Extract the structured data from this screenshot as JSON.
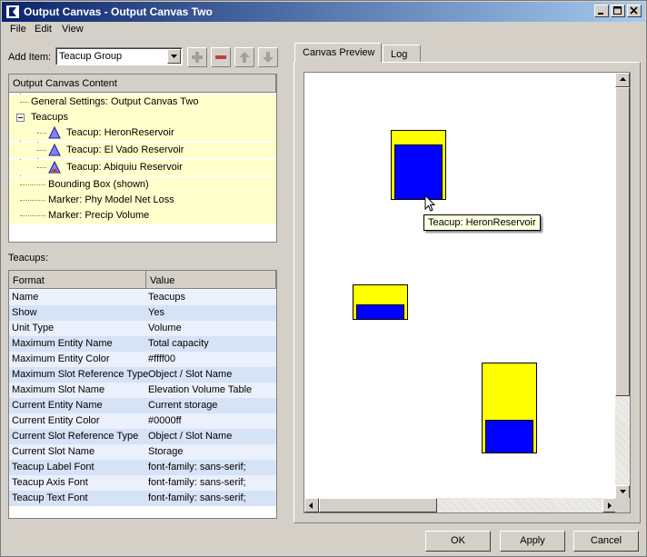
{
  "window": {
    "title": "Output Canvas - Output Canvas Two"
  },
  "menu": [
    "File",
    "Edit",
    "View"
  ],
  "add_item": {
    "label": "Add Item:",
    "selected": "Teacup Group"
  },
  "toolbar_icons": [
    "plus-icon",
    "minus-icon",
    "arrow-up-icon",
    "arrow-down-icon"
  ],
  "tree": {
    "header": "Output Canvas Content",
    "rows": [
      {
        "label": "General Settings: Output Canvas Two",
        "level": 0,
        "icon": ""
      },
      {
        "label": "Teacups",
        "level": 0,
        "icon": "expander"
      },
      {
        "label": "Teacup: HeronReservoir",
        "level": 1,
        "icon": "triangle"
      },
      {
        "label": "Teacup: El Vado Reservoir",
        "level": 1,
        "icon": "triangle"
      },
      {
        "label": "Teacup: Abiquiu Reservoir",
        "level": 1,
        "icon": "triangle"
      },
      {
        "label": "Bounding Box (shown)",
        "level": 0,
        "icon": ""
      },
      {
        "label": "Marker: Phy Model Net Loss",
        "level": 0,
        "icon": ""
      },
      {
        "label": "Marker: Precip Volume",
        "level": 0,
        "icon": ""
      }
    ]
  },
  "properties": {
    "section_label": "Teacups:",
    "headers": [
      "Format",
      "Value"
    ],
    "rows": [
      [
        "Name",
        "Teacups"
      ],
      [
        "Show",
        "Yes"
      ],
      [
        "Unit Type",
        "Volume"
      ],
      [
        "Maximum Entity Name",
        "Total capacity"
      ],
      [
        "Maximum Entity Color",
        "#ffff00"
      ],
      [
        "Maximum Slot Reference Type",
        "Object / Slot Name"
      ],
      [
        "Maximum Slot Name",
        "Elevation Volume Table"
      ],
      [
        "Current Entity Name",
        "Current storage"
      ],
      [
        "Current Entity Color",
        "#0000ff"
      ],
      [
        "Current Slot Reference Type",
        "Object / Slot Name"
      ],
      [
        "Current Slot Name",
        "Storage"
      ],
      [
        "Teacup Label Font",
        "font-family: sans-serif;"
      ],
      [
        "Teacup Axis Font",
        "font-family: sans-serif;"
      ],
      [
        "Teacup Text Font",
        "font-family: sans-serif;"
      ]
    ]
  },
  "tabs": [
    "Canvas Preview",
    "Log"
  ],
  "canvas": {
    "max_color": "#ffff00",
    "current_color": "#0000ff",
    "teacups": [
      {
        "name": "HeronReservoir",
        "current_fraction": 0.86
      },
      {
        "name": "El Vado Reservoir",
        "current_fraction": 0.5
      },
      {
        "name": "Abiquiu Reservoir",
        "current_fraction": 0.39
      }
    ],
    "tooltip": "Teacup: HeronReservoir"
  },
  "buttons": {
    "ok": "OK",
    "apply": "Apply",
    "cancel": "Cancel"
  }
}
